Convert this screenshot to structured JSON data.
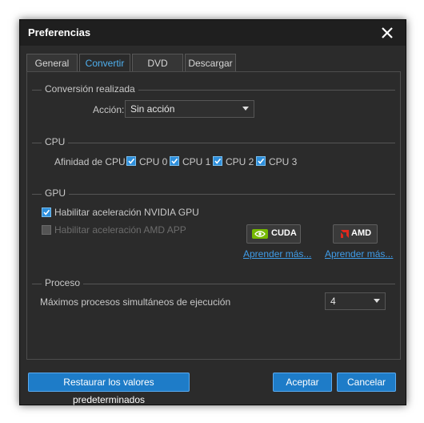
{
  "window": {
    "title": "Preferencias"
  },
  "tabs": [
    {
      "label": "General",
      "active": false
    },
    {
      "label": "Convertir",
      "active": true
    },
    {
      "label": "DVD",
      "active": false
    },
    {
      "label": "Descargar",
      "active": false
    }
  ],
  "conversion": {
    "section_title": "Conversión realizada",
    "action_label": "Acción:",
    "action_value": "Sin acción"
  },
  "cpu": {
    "section_title": "CPU",
    "affinity_label": "Afinidad de CPU:",
    "cores": [
      {
        "label": "CPU 0",
        "checked": true
      },
      {
        "label": "CPU 1",
        "checked": true
      },
      {
        "label": "CPU 2",
        "checked": true
      },
      {
        "label": "CPU 3",
        "checked": true
      }
    ]
  },
  "gpu": {
    "section_title": "GPU",
    "nvidia_label": "Habilitar aceleración NVIDIA GPU",
    "nvidia_checked": true,
    "amd_label": "Habilitar aceleración AMD APP",
    "amd_checked": false,
    "amd_enabled": false,
    "cuda_button": "CUDA",
    "amd_button": "AMD",
    "learn_more_cuda": "Aprender más...",
    "learn_more_amd": "Aprender más..."
  },
  "process": {
    "section_title": "Proceso",
    "max_label": "Máximos procesos simultáneos de ejecución",
    "max_value": "4"
  },
  "footer": {
    "restore_label": "Restaurar los valores predeterminados",
    "accept_label": "Aceptar",
    "cancel_label": "Cancelar"
  },
  "colors": {
    "accent": "#1e7cc8",
    "active_tab_text": "#4fb0ef",
    "link": "#3f9ce8",
    "nvidia_green": "#76b900",
    "amd_red": "#e0281d"
  }
}
